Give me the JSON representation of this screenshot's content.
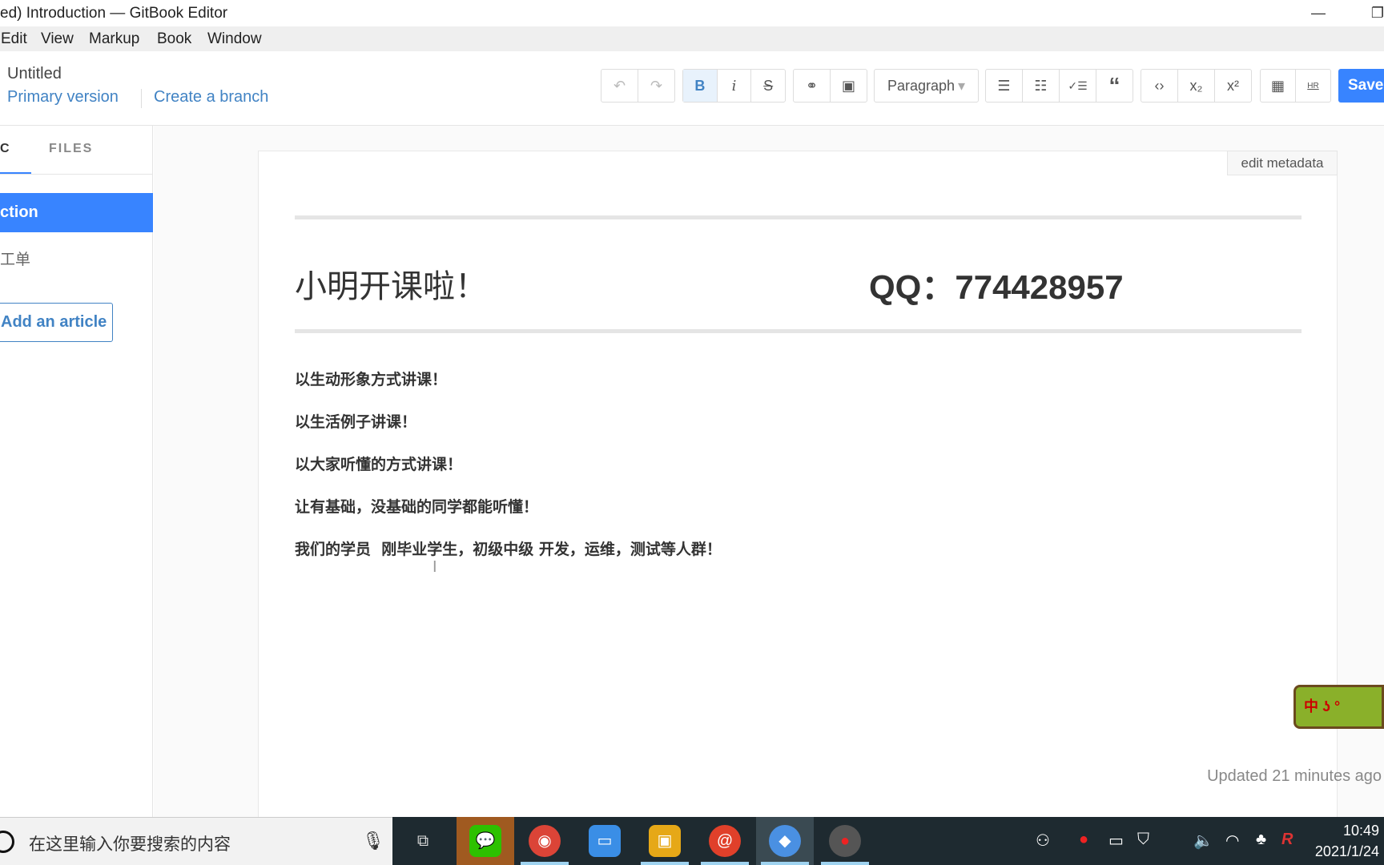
{
  "window": {
    "title": "ed) Introduction — GitBook Editor",
    "minimize_icon": "minimize-icon",
    "restore_icon": "restore-icon"
  },
  "menu": [
    "Edit",
    "View",
    "Markup",
    "Book",
    "Window"
  ],
  "header": {
    "book_title": "Untitled",
    "version_link": "Primary version",
    "branch_link": "Create a branch"
  },
  "toolbar": {
    "undo": "↶",
    "redo": "↷",
    "bold": "B",
    "italic": "i",
    "strike": "S",
    "link": "⚭",
    "image": "▣",
    "paragraph": "Paragraph",
    "paragraph_caret": "▾",
    "ul": "☰",
    "ol": "☷",
    "task": "✓☰",
    "quote": "“",
    "code": "‹›",
    "sub": "x₂",
    "sup": "x²",
    "table": "▦",
    "hr": "HR",
    "save": "Save"
  },
  "sidebar": {
    "tabs": [
      "C",
      "FILES"
    ],
    "active_tab": "C",
    "items": [
      "ction",
      "工单"
    ],
    "add_article": "Add an article"
  },
  "editor": {
    "edit_metadata": "edit metadata",
    "heading_left": "小明开课啦！",
    "heading_right": "QQ：774428957",
    "paragraphs": [
      "以生动形象方式讲课！",
      "以生活例子讲课！",
      "以大家听懂的方式讲课！",
      "让有基础，没基础的同学都能听懂！",
      "我们的学员  刚毕业学生，初级中级 开发，运维，测试等人群！"
    ],
    "cursor": "I",
    "updated": "Updated 21 minutes ago"
  },
  "overlay": {
    "ime_badge": "中 ʖ °"
  },
  "taskbar": {
    "search_placeholder": "在这里输入你要搜索的内容",
    "apps": [
      "task-view",
      "wechat",
      "chrome",
      "remote-desktop",
      "virtualbox",
      "app-red-swirl",
      "gitbook",
      "screen-recorder"
    ],
    "time": "10:49",
    "date": "2021/1/24"
  },
  "colors": {
    "accent": "#3884ff",
    "link": "#4183c4",
    "taskbar": "#1e2a30"
  }
}
